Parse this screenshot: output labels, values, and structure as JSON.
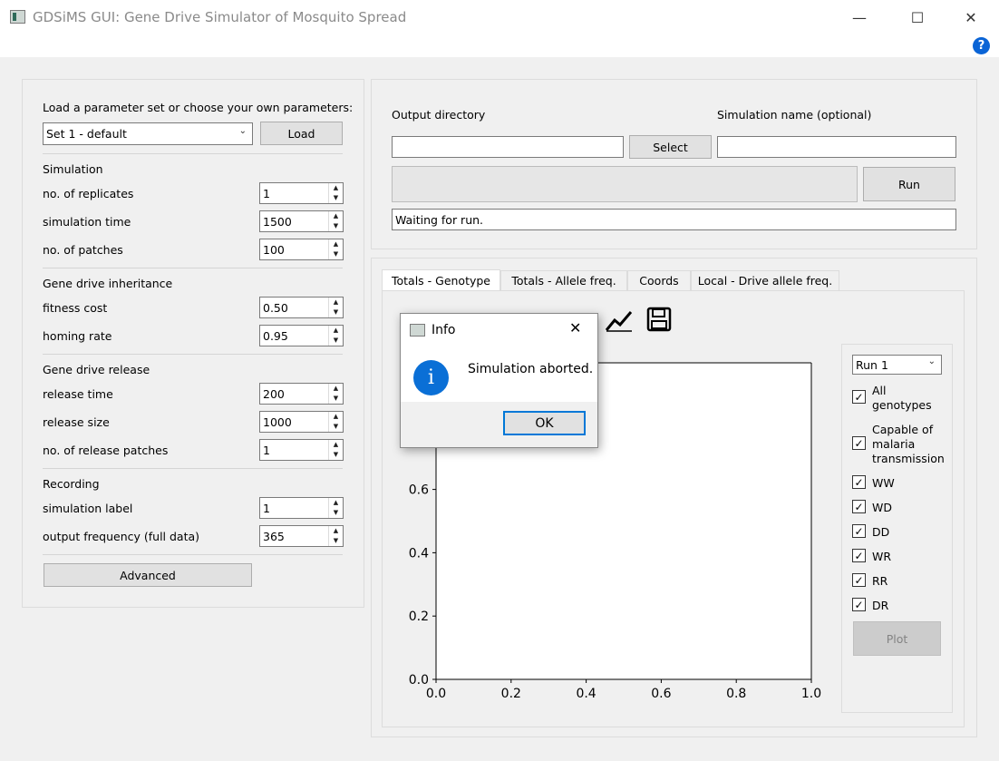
{
  "window": {
    "title": "GDSiMS GUI: Gene Drive Simulator of Mosquito Spread"
  },
  "params": {
    "load_label": "Load a parameter set or choose your own parameters:",
    "set_selected": "Set 1 - default",
    "load_button": "Load",
    "advanced_button": "Advanced",
    "sections": [
      {
        "heading": "Simulation",
        "fields": [
          {
            "label": "no. of replicates",
            "value": "1"
          },
          {
            "label": "simulation time",
            "value": "1500"
          },
          {
            "label": "no. of patches",
            "value": "100"
          }
        ]
      },
      {
        "heading": "Gene drive inheritance",
        "fields": [
          {
            "label": "fitness cost",
            "value": "0.50"
          },
          {
            "label": "homing rate",
            "value": "0.95"
          }
        ]
      },
      {
        "heading": "Gene drive release",
        "fields": [
          {
            "label": "release time",
            "value": "200"
          },
          {
            "label": "release size",
            "value": "1000"
          },
          {
            "label": "no. of release patches",
            "value": "1"
          }
        ]
      },
      {
        "heading": "Recording",
        "fields": [
          {
            "label": "simulation label",
            "value": "1"
          },
          {
            "label": "output frequency (full data)",
            "value": "365"
          }
        ]
      }
    ]
  },
  "output": {
    "dir_label": "Output directory",
    "sim_name_label": "Simulation name (optional)",
    "select_button": "Select",
    "run_button": "Run",
    "status": "Waiting for run.",
    "dir_value": "",
    "sim_name_value": ""
  },
  "tabs": [
    "Totals - Genotype",
    "Totals - Allele freq.",
    "Coords",
    "Local - Drive allele freq."
  ],
  "plot_controls": {
    "run_selected": "Run 1",
    "checkboxes": [
      {
        "label": "All genotypes",
        "checked": true
      },
      {
        "label": "Capable of malaria transmission",
        "checked": true
      },
      {
        "label": "WW",
        "checked": true
      },
      {
        "label": "WD",
        "checked": true
      },
      {
        "label": "DD",
        "checked": true
      },
      {
        "label": "WR",
        "checked": true
      },
      {
        "label": "RR",
        "checked": true
      },
      {
        "label": "DR",
        "checked": true
      }
    ],
    "plot_button": "Plot"
  },
  "chart_data": {
    "type": "line",
    "xlim": [
      0.0,
      1.0
    ],
    "ylim": [
      0.0,
      1.0
    ],
    "x_ticks": [
      "0.0",
      "0.2",
      "0.4",
      "0.6",
      "0.8",
      "1.0"
    ],
    "y_ticks": [
      "0.0",
      "0.2",
      "0.4",
      "0.6"
    ],
    "series": []
  },
  "dialog": {
    "title": "Info",
    "message": "Simulation aborted.",
    "ok_button": "OK",
    "icon": "info-icon"
  }
}
